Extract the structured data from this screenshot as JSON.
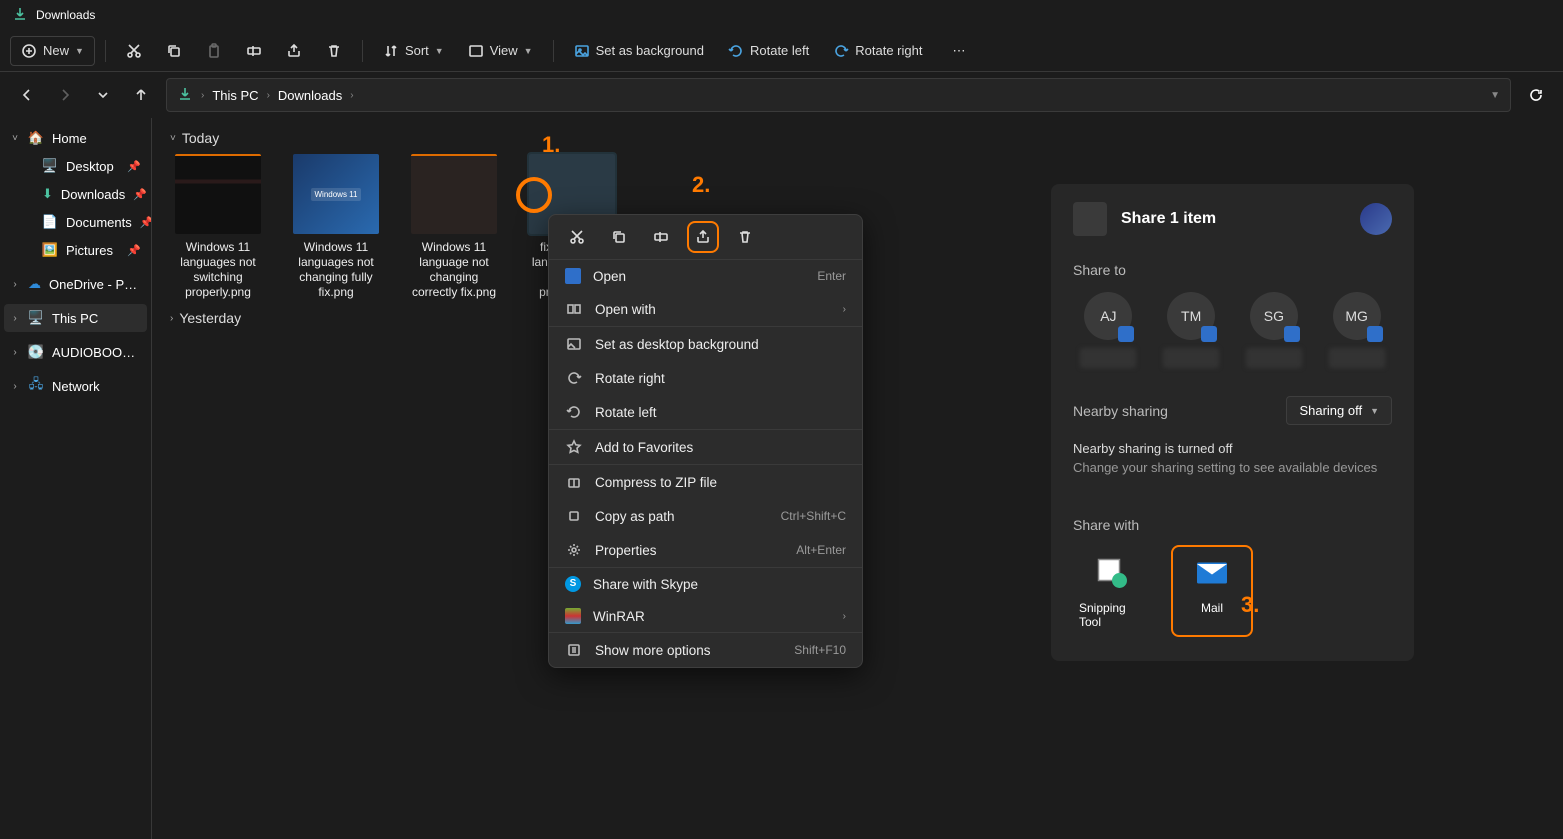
{
  "titlebar": {
    "title": "Downloads"
  },
  "toolbar": {
    "new": "New",
    "sort": "Sort",
    "view": "View",
    "set_bg": "Set as background",
    "rotate_left": "Rotate left",
    "rotate_right": "Rotate right"
  },
  "breadcrumb": {
    "root": "This PC",
    "current": "Downloads"
  },
  "sidebar": {
    "home": "Home",
    "desktop": "Desktop",
    "downloads": "Downloads",
    "documents": "Documents",
    "pictures": "Pictures",
    "onedrive": "OneDrive - Personal",
    "thispc": "This PC",
    "audiobooks": "AUDIOBOOKS (D:)",
    "network": "Network"
  },
  "groups": {
    "today": "Today",
    "yesterday": "Yesterday"
  },
  "files": [
    {
      "name": "Windows 11 languages not switching properly.png"
    },
    {
      "name": "Windows 11 languages not changing fully fix.png",
      "badge": "Windows 11"
    },
    {
      "name": "Windows 11 language not changing correctly fix.png"
    },
    {
      "name": "fix Windows language won't change properly.png"
    }
  ],
  "ctx": {
    "open": "Open",
    "open_kbd": "Enter",
    "openwith": "Open with",
    "setbg": "Set as desktop background",
    "rright": "Rotate right",
    "rleft": "Rotate left",
    "fav": "Add to Favorites",
    "zip": "Compress to ZIP file",
    "copypath": "Copy as path",
    "copypath_kbd": "Ctrl+Shift+C",
    "props": "Properties",
    "props_kbd": "Alt+Enter",
    "skype": "Share with Skype",
    "winrar": "WinRAR",
    "more": "Show more options",
    "more_kbd": "Shift+F10"
  },
  "share": {
    "title": "Share 1 item",
    "shareto": "Share to",
    "contacts": [
      "AJ",
      "TM",
      "SG",
      "MG"
    ],
    "nearby": "Nearby sharing",
    "nearby_sel": "Sharing off",
    "nearby_off": "Nearby sharing is turned off",
    "nearby_sub": "Change your sharing setting to see available devices",
    "sharewith": "Share with",
    "apps": [
      {
        "name": "Snipping Tool"
      },
      {
        "name": "Mail"
      }
    ]
  },
  "annot": {
    "n1": "1.",
    "n2": "2.",
    "n3": "3."
  }
}
